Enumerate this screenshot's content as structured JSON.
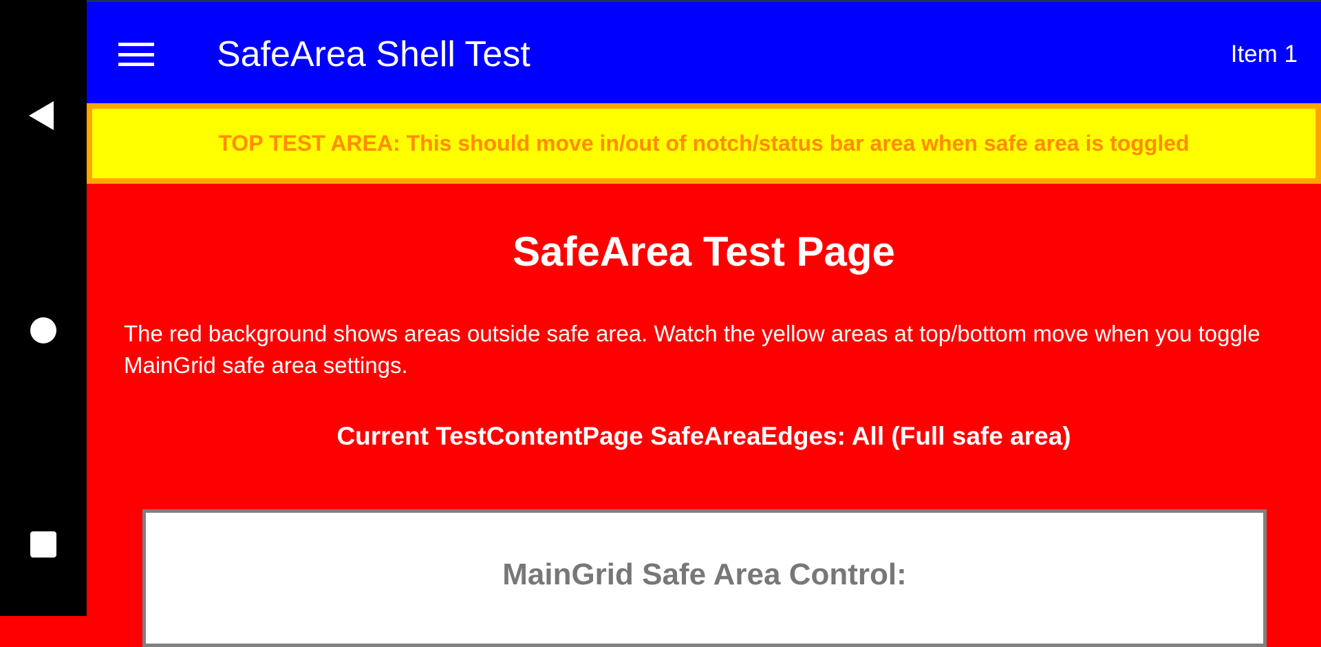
{
  "system_nav": {
    "icons": [
      "back-icon",
      "home-icon",
      "recents-icon"
    ]
  },
  "appbar": {
    "title": "SafeArea Shell Test",
    "toolbar_item": "Item 1",
    "color": "#0000ff"
  },
  "top_test_area": {
    "text": "TOP TEST AREA: This should move in/out of notch/status bar area when safe area is toggled"
  },
  "main": {
    "heading": "SafeArea Test Page",
    "description": "The red background shows areas outside safe area. Watch the yellow areas at top/bottom move when you toggle MainGrid safe area settings.",
    "current_edges": "Current TestContentPage SafeAreaEdges: All (Full safe area)",
    "control_panel": {
      "title": "MainGrid Safe Area Control:"
    }
  }
}
